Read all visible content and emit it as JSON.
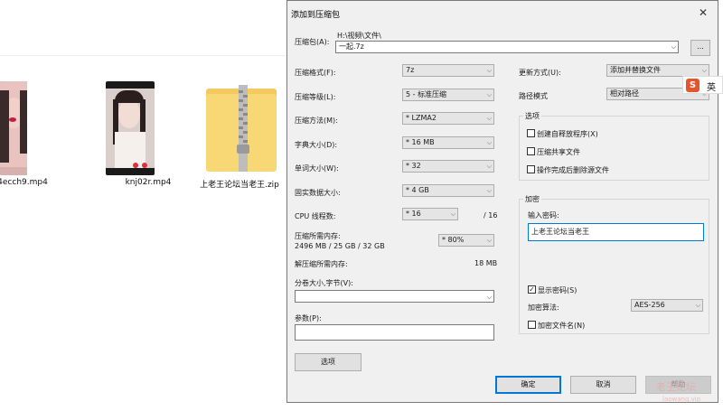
{
  "explorer": {
    "files": [
      {
        "name": "4ecch9.mp4",
        "type": "video"
      },
      {
        "name": "knj02r.mp4",
        "type": "video"
      },
      {
        "name": "上老王论坛当老王.zip",
        "type": "zip-folder"
      }
    ]
  },
  "dialog": {
    "title": "添加到压缩包",
    "close_label": "✕",
    "archive": {
      "label": "压缩包(A):",
      "path": "H:\\视频\\文件\\",
      "name_value": "一起.7z",
      "browse_label": "..."
    },
    "left": {
      "format": {
        "label": "压缩格式(F):",
        "value": "7z"
      },
      "level": {
        "label": "压缩等级(L):",
        "value": "5 - 标准压缩"
      },
      "method": {
        "label": "压缩方法(M):",
        "value": "* LZMA2"
      },
      "dict": {
        "label": "字典大小(D):",
        "value": "* 16 MB"
      },
      "word": {
        "label": "单词大小(W):",
        "value": "* 32"
      },
      "solid": {
        "label": "固实数据大小:",
        "value": "* 4 GB"
      },
      "cpu": {
        "label": "CPU 线程数:",
        "value": "* 16",
        "max": "/ 16"
      },
      "mem_compress": {
        "label": "压缩所需内存:",
        "value": "2496 MB / 25 GB / 32 GB",
        "percent": "* 80%"
      },
      "mem_decompress": {
        "label": "解压缩所需内存:",
        "value": "18 MB"
      },
      "split": {
        "label": "分卷大小,字节(V):",
        "value": ""
      },
      "params": {
        "label": "参数(P):",
        "value": ""
      },
      "options_button": "选项"
    },
    "right": {
      "update": {
        "label": "更新方式(U):",
        "value": "添加并替换文件"
      },
      "pathmode": {
        "label": "路径模式",
        "value": "相对路径"
      },
      "options_group": {
        "title": "选项",
        "sfx": {
          "label": "创建自释放程序(X)",
          "checked": false
        },
        "shared": {
          "label": "压缩共享文件",
          "checked": false
        },
        "delete": {
          "label": "操作完成后删除源文件",
          "checked": false
        }
      },
      "encryption_group": {
        "title": "加密",
        "password_label": "输入密码:",
        "password_value": "上老王论坛当老王",
        "show_password": {
          "label": "显示密码(S)",
          "checked": true
        },
        "method_label": "加密算法:",
        "method_value": "AES-256",
        "encrypt_names": {
          "label": "加密文件名(N)",
          "checked": false
        }
      }
    },
    "buttons": {
      "ok": "确定",
      "cancel": "取消",
      "help": "帮助"
    }
  },
  "ime": {
    "logo": "S",
    "lang": "英"
  },
  "watermark": {
    "line1": "老王论坛",
    "line2": "laowang.vip"
  },
  "colors": {
    "accent": "#0078d7",
    "ime": "#e8532b",
    "folder": "#f8d775"
  }
}
